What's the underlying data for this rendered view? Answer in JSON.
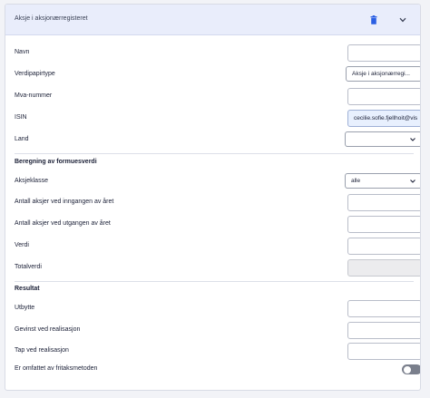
{
  "header": {
    "title": "Aksje i aksjonærregisteret",
    "delete_icon": "trash-icon",
    "collapse_icon": "chevron-down-icon"
  },
  "fields": {
    "navn": {
      "label": "Navn",
      "value": ""
    },
    "verdipapirtype": {
      "label": "Verdipapirtype",
      "value": "Aksje i aksjonærregi..."
    },
    "mva": {
      "label": "Mva-nummer",
      "value": ""
    },
    "isin": {
      "label": "ISIN",
      "value": "cecilie.sofie.fjellhoit@vis"
    },
    "land": {
      "label": "Land",
      "value": ""
    }
  },
  "beregning": {
    "heading": "Beregning av formuesverdi",
    "aksjeklasse": {
      "label": "Aksjeklasse",
      "value": "alle"
    },
    "antall_inngang": {
      "label": "Antall aksjer ved inngangen av året",
      "value": ""
    },
    "antall_utgang": {
      "label": "Antall aksjer ved utgangen av året",
      "value": ""
    },
    "verdi": {
      "label": "Verdi",
      "value": ""
    },
    "totalverdi": {
      "label": "Totalverdi",
      "value": ""
    }
  },
  "resultat": {
    "heading": "Resultat",
    "utbytte": {
      "label": "Utbytte",
      "value": ""
    },
    "gevinst": {
      "label": "Gevinst ved realisasjon",
      "value": ""
    },
    "tap": {
      "label": "Tap ved realisasjon",
      "value": ""
    },
    "fritak": {
      "label": "Er omfattet av fritaksmetoden",
      "on": false
    }
  },
  "colors": {
    "header_bg": "#e9edfb",
    "autofill_bg": "#e8f0fe",
    "toggle_off": "#7a7f8c",
    "icon_blue": "#2b5fe3"
  }
}
